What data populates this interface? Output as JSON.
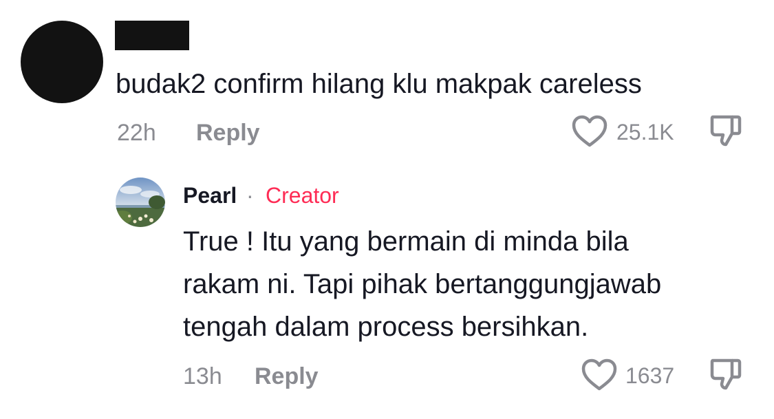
{
  "comments": [
    {
      "author_redacted": true,
      "text": "budak2 confirm hilang klu makpak careless",
      "time": "22h",
      "reply_label": "Reply",
      "like_count": "25.1K",
      "replies": [
        {
          "author": "Pearl",
          "separator": "·",
          "badge": "Creator",
          "text_lines": [
            "True ! Itu yang bermain di minda bila",
            "rakam ni. Tapi pihak bertanggungjawab",
            "tengah dalam process bersihkan."
          ],
          "time": "13h",
          "reply_label": "Reply",
          "like_count": "1637"
        }
      ]
    }
  ],
  "icons": {
    "like": "heart-outline-icon",
    "dislike": "thumbs-down-icon"
  },
  "colors": {
    "text_primary": "#161823",
    "text_secondary": "#8a8b91",
    "creator_badge": "#fe2c55",
    "redaction": "#121212"
  }
}
